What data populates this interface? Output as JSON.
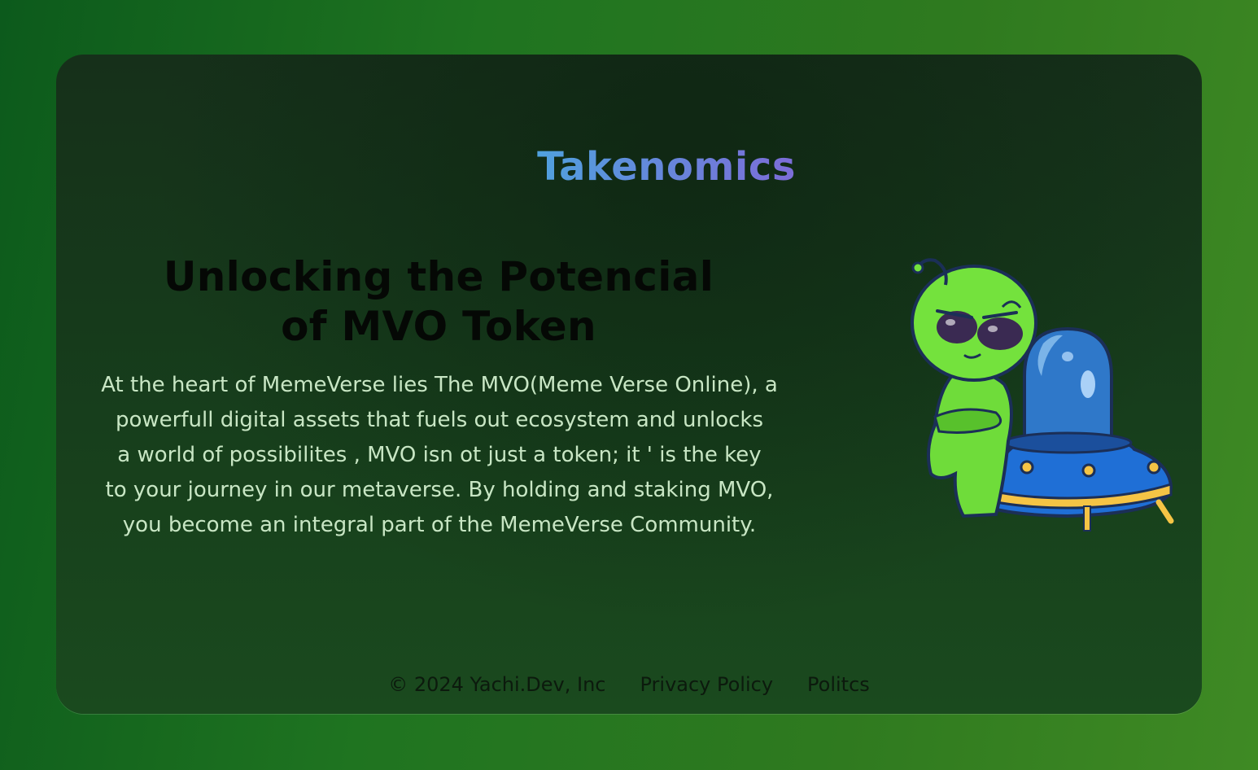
{
  "section": {
    "title": "Takenomics"
  },
  "hero": {
    "headline_lines": [
      "Unlocking the Potencial",
      "of MVO Token"
    ],
    "body_lines": [
      "At the heart of MemeVerse lies The MVO(Meme Verse Online), a",
      "powerfull digital assets that fuels out ecosystem and unlocks",
      "a world of possibilites , MVO isn ot just a token; it ' is the key",
      "to your journey in our metaverse. By holding and staking MVO,",
      "you become an integral part of the MemeVerse Community."
    ]
  },
  "illustration": {
    "icon": "alien-with-ufo-icon"
  },
  "footer": {
    "copyright": "© 2024 Yachi.Dev, Inc",
    "links": [
      "Privacy Policy",
      "Politcs"
    ]
  },
  "colors": {
    "page_gradient_start": "#0c5a1c",
    "page_gradient_end": "#3f8a24",
    "card_bg": "#163a1b",
    "title_gradient": [
      "#19d3d6",
      "#7a6fd8",
      "#c53ad4"
    ],
    "body_text": "#c8e6c4",
    "headline_text": "#050805"
  }
}
